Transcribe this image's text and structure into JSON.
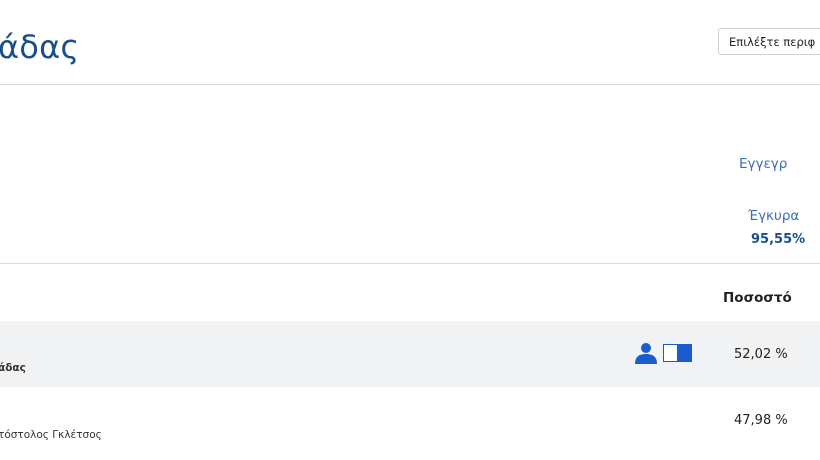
{
  "header": {
    "title": "άδας",
    "region_select": {
      "selected": "Επιλέξτε περιφ"
    }
  },
  "summary": {
    "registered_label": "Εγγεγρ",
    "valid_label": "Έγκυρα",
    "valid_value": "95,55%"
  },
  "table": {
    "percent_header": "Ποσοστό",
    "rows": [
      {
        "name": "άδας",
        "percent": "52,02 %",
        "elected": true
      },
      {
        "name": "τόστολος Γκλέτσος",
        "percent": "47,98 %",
        "elected": false
      }
    ]
  },
  "colors": {
    "accent": "#1a4f8c",
    "link": "#3c6cb4",
    "icon": "#1a5bd0",
    "row_highlight": "#f1f2f4"
  }
}
